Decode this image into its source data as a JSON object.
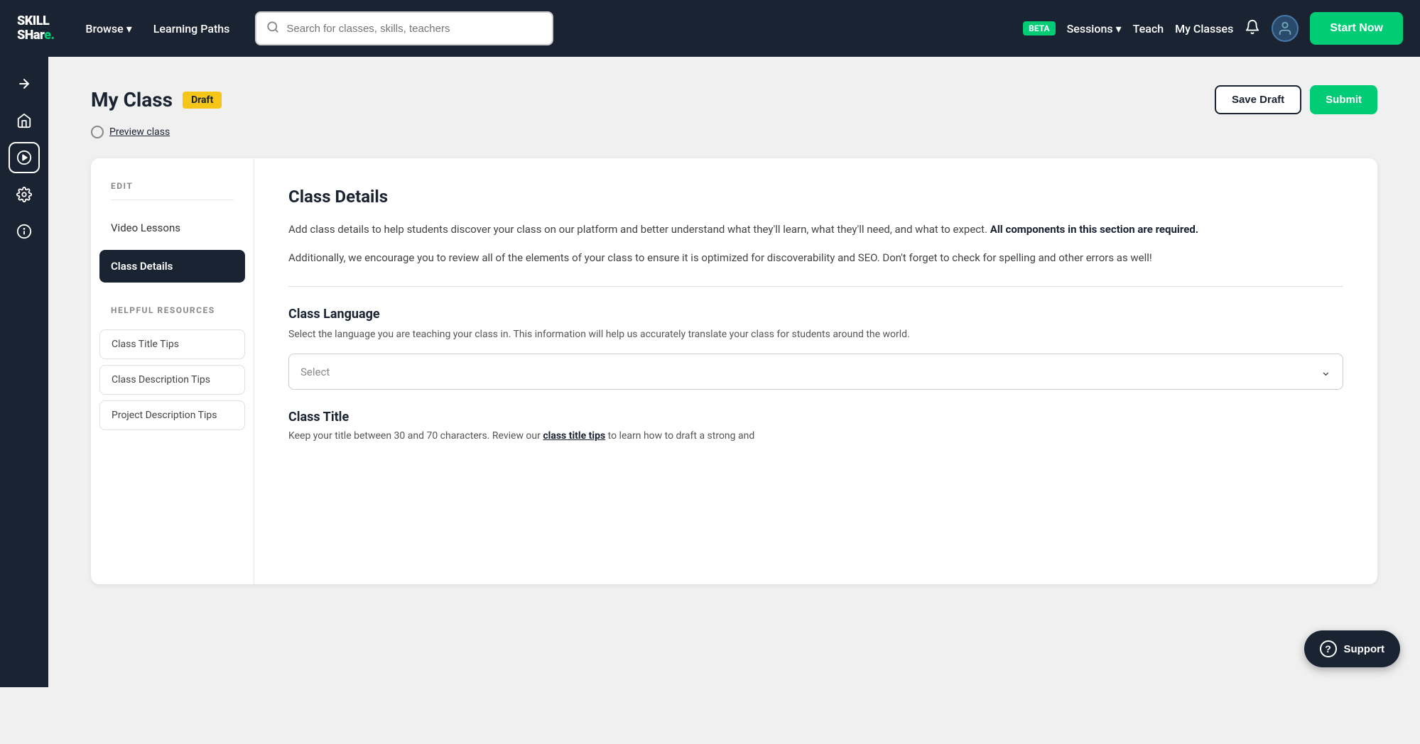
{
  "navbar": {
    "logo_line1": "SKILL",
    "logo_line2": "SHare",
    "browse_label": "Browse",
    "learning_paths_label": "Learning Paths",
    "search_placeholder": "Search for classes, skills, teachers",
    "beta_label": "BETA",
    "sessions_label": "Sessions",
    "teach_label": "Teach",
    "my_classes_label": "My Classes",
    "start_now_label": "Start Now"
  },
  "page": {
    "title": "My Class",
    "draft_badge": "Draft",
    "save_draft_label": "Save Draft",
    "submit_label": "Submit",
    "preview_label": "Preview class"
  },
  "left_nav": {
    "edit_label": "EDIT",
    "video_lessons_label": "Video Lessons",
    "class_details_label": "Class Details",
    "helpful_resources_label": "HELPFUL RESOURCES",
    "resources": [
      {
        "label": "Class Title Tips"
      },
      {
        "label": "Class Description Tips"
      },
      {
        "label": "Project Description Tips"
      }
    ]
  },
  "class_details": {
    "section_title": "Class Details",
    "description1": "Add class details to help students discover your class on our platform and better understand what they'll learn, what they'll need, and what to expect.",
    "description1_bold": " All components in this section are required.",
    "description2": "Additionally, we encourage you to review all of the elements of your class to ensure it is optimized for discoverability and SEO. Don't forget to check for spelling and other errors as well!",
    "language_label": "Class Language",
    "language_desc": "Select the language you are teaching your class in. This information will help us accurately translate your class for students around the world.",
    "language_select_placeholder": "Select",
    "title_label": "Class Title",
    "title_desc": "Keep your title between 30 and 70 characters. Review our",
    "title_desc_link": "class title tips",
    "title_desc_end": " to learn how to draft a strong and"
  },
  "support": {
    "label": "Support"
  }
}
